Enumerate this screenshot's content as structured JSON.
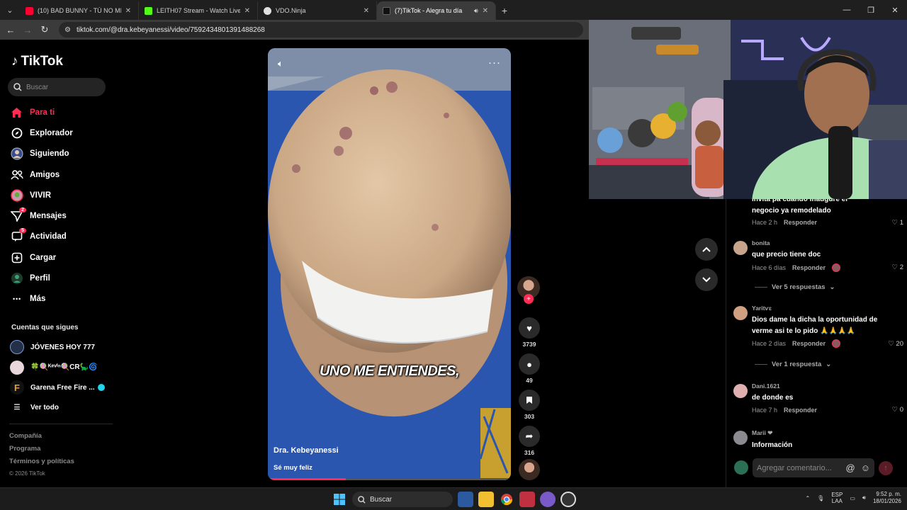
{
  "browser": {
    "tabs": [
      {
        "title": "(10) BAD BUNNY - TÚ NO METI",
        "favicon_color": "#ff0033"
      },
      {
        "title": "LEITH07 Stream - Watch Live o",
        "favicon_color": "#53fc18"
      },
      {
        "title": "VDO.Ninja",
        "favicon_color": "#e0e0e0"
      },
      {
        "title": "(7)TikTok - Alegra tu día",
        "favicon_color": "#111111"
      }
    ],
    "url": "tiktok.com/@dra.kebeyanessi/video/7592434801391488268"
  },
  "sidebar": {
    "logo_text": "TikTok",
    "search_placeholder": "Buscar",
    "nav": [
      {
        "label": "Para ti",
        "icon": "home-icon"
      },
      {
        "label": "Explorador",
        "icon": "compass-icon"
      },
      {
        "label": "Siguiendo",
        "icon": "following-icon"
      },
      {
        "label": "Amigos",
        "icon": "friends-icon"
      },
      {
        "label": "VIVIR",
        "icon": "live-icon"
      },
      {
        "label": "Mensajes",
        "icon": "messages-icon",
        "badge": "2"
      },
      {
        "label": "Actividad",
        "icon": "activity-icon",
        "badge": "5"
      },
      {
        "label": "Cargar",
        "icon": "upload-icon"
      },
      {
        "label": "Perfil",
        "icon": "profile-icon"
      },
      {
        "label": "Más",
        "icon": "more-icon"
      }
    ],
    "following_header": "Cuentas que sigues",
    "following": [
      {
        "name": "JÓVENES HOY 777"
      },
      {
        "name": "🍀🍭ᴷᵉᵛⁱⁿ🍭CR🦕🌀"
      },
      {
        "name": "Garena Free Fire ..."
      },
      {
        "name": "Ver todo"
      }
    ],
    "footer": [
      "Compañía",
      "Programa",
      "Términos y políticas"
    ],
    "copyright": "© 2026 TikTok"
  },
  "video": {
    "caption": "UNO ME ENTIENDES,",
    "author": "Dra. Kebeyanessi",
    "description": "Sé muy feliz",
    "progress": 0.32
  },
  "actions": {
    "likes": "3739",
    "comments": "49",
    "saves": "303",
    "shares": "316"
  },
  "comments": [
    {
      "user": "",
      "text": "invita pa cuando inaugure el negocio ya remodelado",
      "time": "Hace 2 h",
      "reply": "Responder",
      "likes": "1"
    },
    {
      "user": "bonita",
      "text": "que precio tiene doc",
      "time": "Hace 6 días",
      "reply": "Responder",
      "likes": "2",
      "more": "Ver 5 respuestas"
    },
    {
      "user": "Yaritѵɛ",
      "text": "Dios dame la dicha la oportunidad de verme asi te lo pido 🙏🙏🙏🙏",
      "time": "Hace 2 días",
      "reply": "Responder",
      "likes": "20",
      "more": "Ver 1 respuesta"
    },
    {
      "user": "Dani.1621",
      "text": "de donde es",
      "time": "Hace 7 h",
      "reply": "Responder",
      "likes": "0"
    },
    {
      "user": "Marii ❤",
      "text": "Información"
    }
  ],
  "comment_box": {
    "placeholder": "Agregar comentario..."
  },
  "taskbar": {
    "search_label": "Buscar",
    "lang_top": "ESP",
    "lang_bottom": "LAA",
    "time": "9:52 p. m.",
    "date": "18/01/2026"
  }
}
